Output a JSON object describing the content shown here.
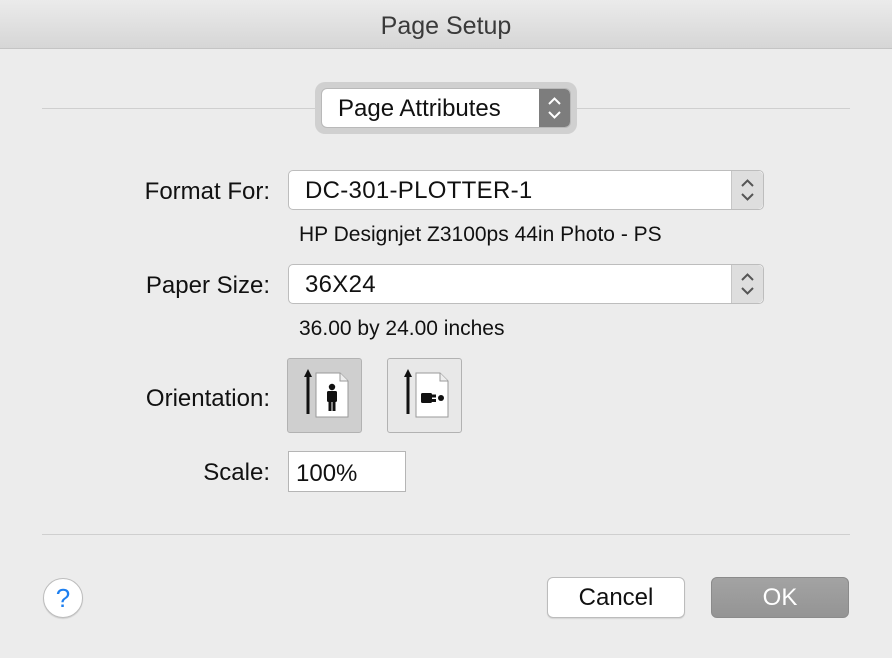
{
  "window": {
    "title": "Page Setup"
  },
  "panel_popup": {
    "selected": "Page Attributes"
  },
  "format_for": {
    "label": "Format For:",
    "value": "DC-301-PLOTTER-1",
    "description": "HP Designjet Z3100ps 44in Photo - PS"
  },
  "paper_size": {
    "label": "Paper Size:",
    "value": "36X24",
    "description": "36.00 by 24.00 inches"
  },
  "orientation": {
    "label": "Orientation:",
    "options": [
      {
        "name": "portrait",
        "icon": "portrait-orientation-icon",
        "selected": true
      },
      {
        "name": "landscape",
        "icon": "landscape-orientation-icon",
        "selected": false
      }
    ]
  },
  "scale": {
    "label": "Scale:",
    "value": "100%"
  },
  "help": {
    "glyph": "?"
  },
  "buttons": {
    "cancel": "Cancel",
    "ok": "OK"
  },
  "colors": {
    "window_bg": "#ececec",
    "ok_button_bg": "#9c9c9c",
    "help_glyph": "#1d7ff0"
  }
}
